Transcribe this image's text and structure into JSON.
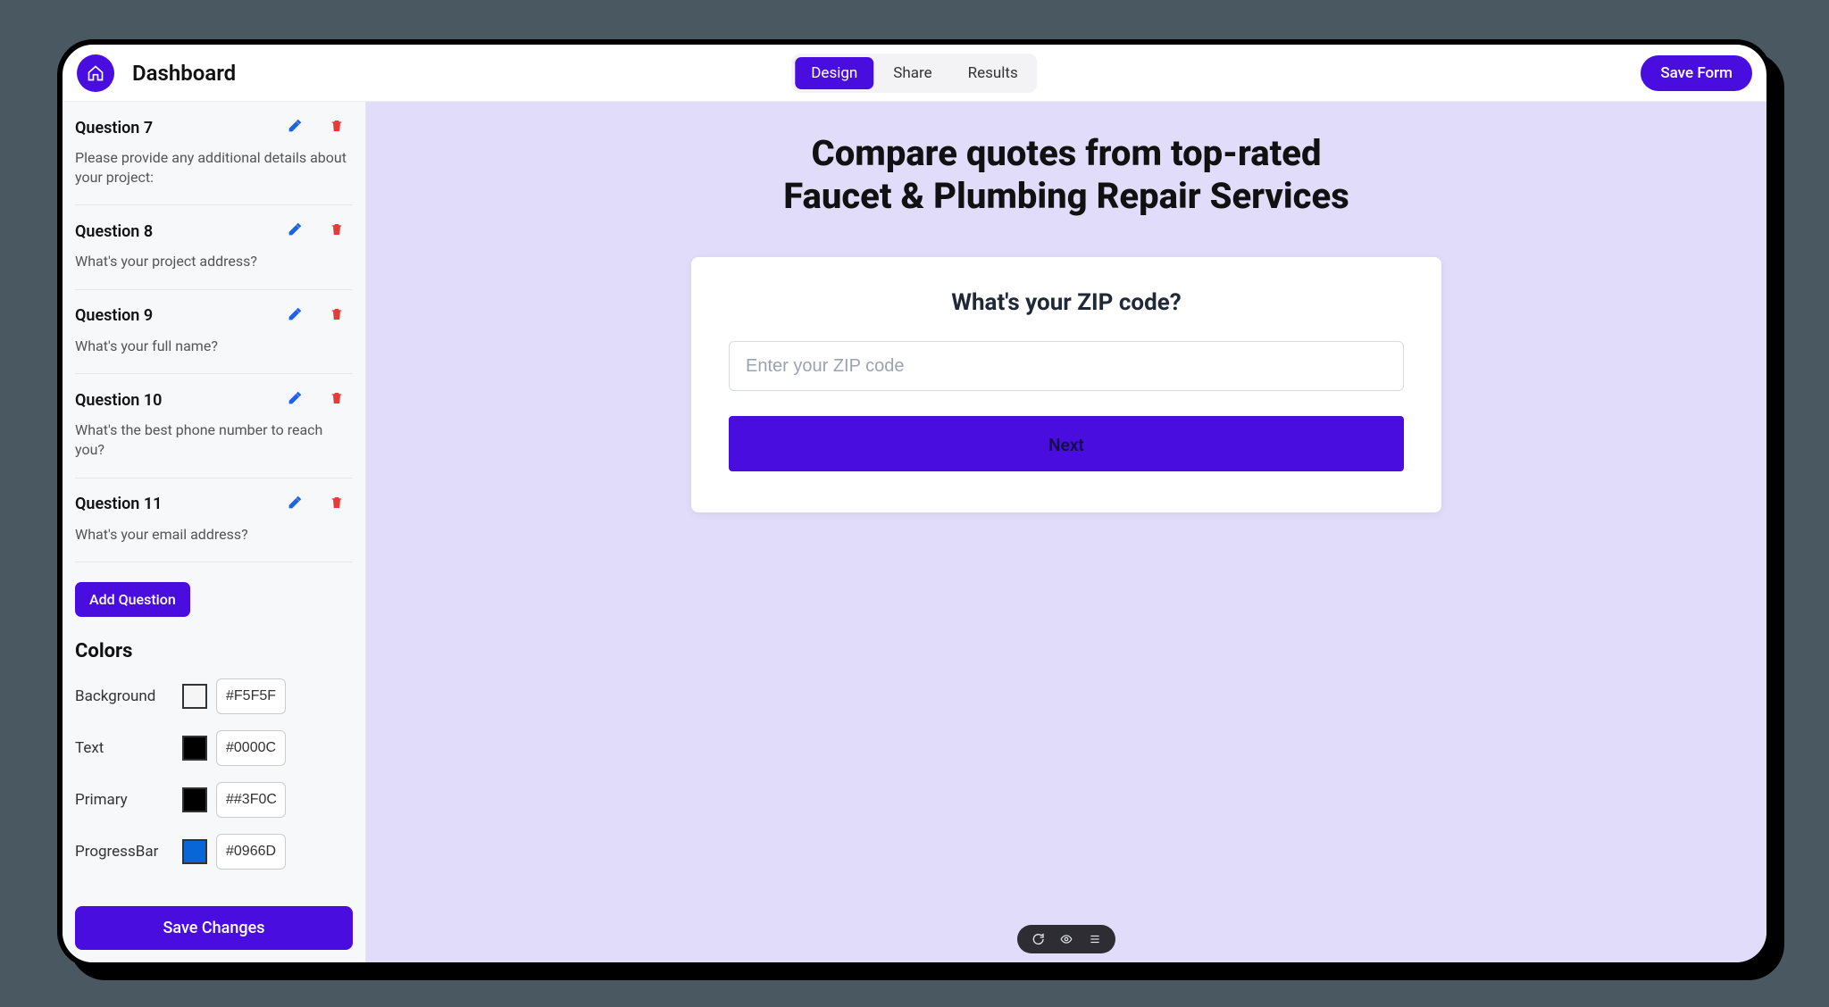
{
  "header": {
    "title": "Dashboard",
    "tabs": {
      "design": "Design",
      "share": "Share",
      "results": "Results"
    },
    "save": "Save Form"
  },
  "sidebar": {
    "questions": [
      {
        "label": "Question 7",
        "text": "Please provide any additional details about your project:"
      },
      {
        "label": "Question 8",
        "text": "What's your project address?"
      },
      {
        "label": "Question 9",
        "text": "What's your full name?"
      },
      {
        "label": "Question 10",
        "text": "What's the best phone number to reach you?"
      },
      {
        "label": "Question 11",
        "text": "What's your email address?"
      }
    ],
    "add_question": "Add Question",
    "colors_title": "Colors",
    "color_rows": {
      "background": {
        "label": "Background",
        "value": "#F5F5F",
        "swatch": "#f5f5f5"
      },
      "text": {
        "label": "Text",
        "value": "#0000C",
        "swatch": "#000000"
      },
      "primary": {
        "label": "Primary",
        "value": "##3F0C",
        "swatch": "#000000"
      },
      "progressbar": {
        "label": "ProgressBar",
        "value": "#0966D",
        "swatch": "#0966d6"
      }
    },
    "save_changes": "Save Changes"
  },
  "preview": {
    "title_line1": "Compare quotes from top-rated",
    "title_line2": "Faucet & Plumbing Repair Services",
    "card_question": "What's your ZIP code?",
    "zip_placeholder": "Enter your ZIP code",
    "next": "Next"
  }
}
